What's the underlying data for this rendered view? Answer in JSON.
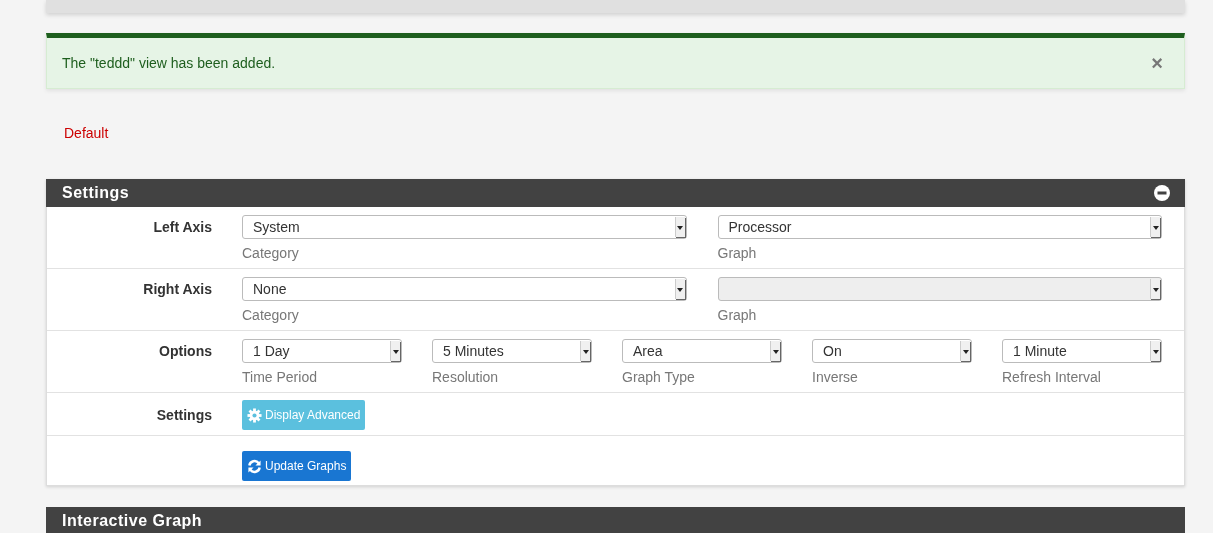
{
  "alert": {
    "message": "The \"teddd\" view has been added.",
    "close": "×"
  },
  "view_link": "Default",
  "settings_panel": {
    "title": "Settings",
    "rows": [
      {
        "kind": "selects",
        "label": "Left Axis",
        "fields": [
          {
            "value": "System",
            "caption": "Category",
            "disabled": false
          },
          {
            "value": "Processor",
            "caption": "Graph",
            "disabled": false
          }
        ]
      },
      {
        "kind": "selects",
        "label": "Right Axis",
        "fields": [
          {
            "value": "None",
            "caption": "Category",
            "disabled": false
          },
          {
            "caption": "Graph",
            "disabled": true
          }
        ]
      },
      {
        "kind": "selects",
        "label": "Options",
        "fields": [
          {
            "value": "1 Day",
            "caption": "Time Period",
            "disabled": false
          },
          {
            "value": "5 Minutes",
            "caption": "Resolution",
            "disabled": false
          },
          {
            "value": "Area",
            "caption": "Graph Type",
            "disabled": false
          },
          {
            "value": "On",
            "caption": "Inverse",
            "disabled": false
          },
          {
            "value": "1 Minute",
            "caption": "Refresh Interval",
            "disabled": false
          }
        ]
      },
      {
        "kind": "advanced_button",
        "label": "Settings",
        "button": {
          "label": "Display Advanced"
        }
      },
      {
        "kind": "update_button",
        "button": {
          "label": "Update Graphs"
        }
      }
    ]
  },
  "interactive_panel": {
    "title": "Interactive Graph"
  }
}
